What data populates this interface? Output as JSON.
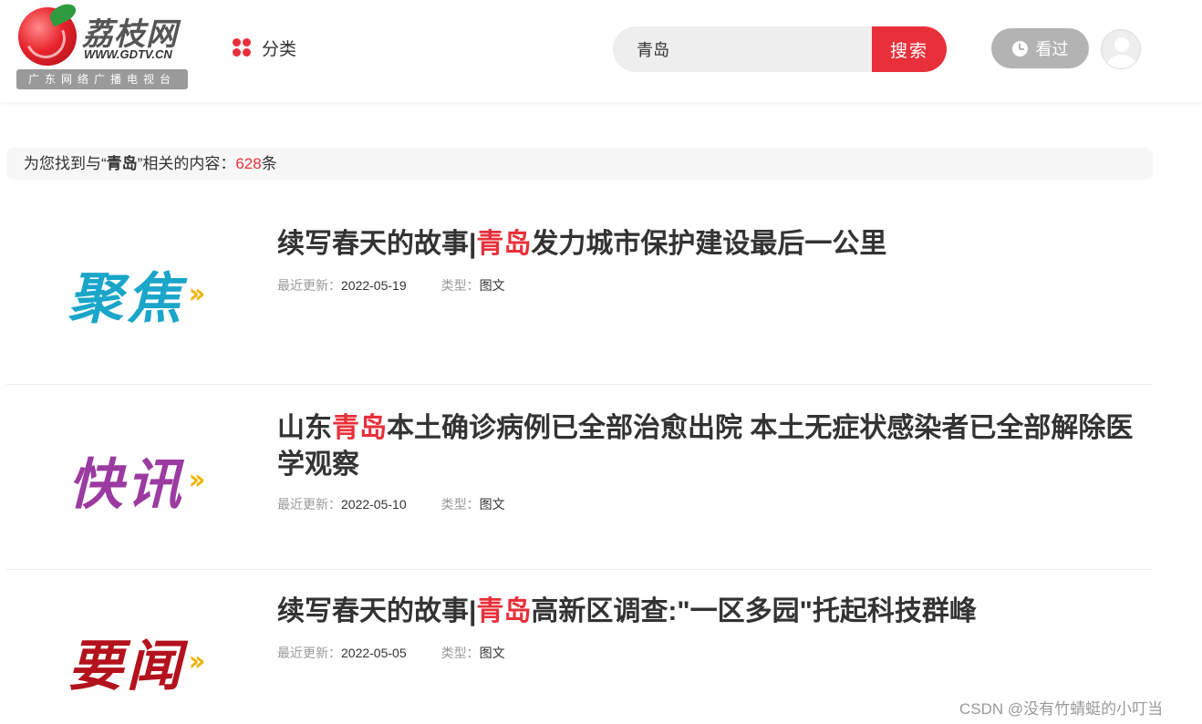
{
  "header": {
    "logo": {
      "title": "荔枝网",
      "url": "WWW.GDTV.CN",
      "tagline": "广东网络广播电视台"
    },
    "category_label": "分类",
    "search": {
      "value": "青岛",
      "button_label": "搜索"
    },
    "history_label": "看过"
  },
  "summary": {
    "prefix": "为您找到与",
    "open_quote": "“",
    "keyword": "青岛",
    "close_quote": "”",
    "middle": "相关的内容：",
    "count": "628",
    "suffix": "条"
  },
  "results": [
    {
      "thumb_text": "聚焦",
      "thumb_arrows": "››",
      "title_pre": "续写春天的故事|",
      "title_hl": "青岛",
      "title_post": "发力城市保护建设最后一公里",
      "updated_label": "最近更新：",
      "updated": "2022-05-19",
      "type_label": "类型：",
      "type": "图文"
    },
    {
      "thumb_text": "快讯",
      "thumb_arrows": "››",
      "title_pre": "山东",
      "title_hl": "青岛",
      "title_post": "本土确诊病例已全部治愈出院 本土无症状感染者已全部解除医学观察",
      "updated_label": "最近更新：",
      "updated": "2022-05-10",
      "type_label": "类型：",
      "type": "图文"
    },
    {
      "thumb_text": "要闻",
      "thumb_arrows": "››",
      "title_pre": "续写春天的故事|",
      "title_hl": "青岛",
      "title_post": "高新区调查:\"一区多园\"托起科技群峰",
      "updated_label": "最近更新：",
      "updated": "2022-05-05",
      "type_label": "类型：",
      "type": "图文"
    }
  ],
  "watermark": "CSDN @没有竹蜻蜓的小叮当",
  "colors": {
    "accent": "#e8303a",
    "history_bg": "#b3b3b3",
    "thumb_focus": "#1aa6c9",
    "thumb_flash": "#9b3aa0",
    "thumb_news": "#b3121d",
    "arrow_gold": "#f0b400"
  }
}
